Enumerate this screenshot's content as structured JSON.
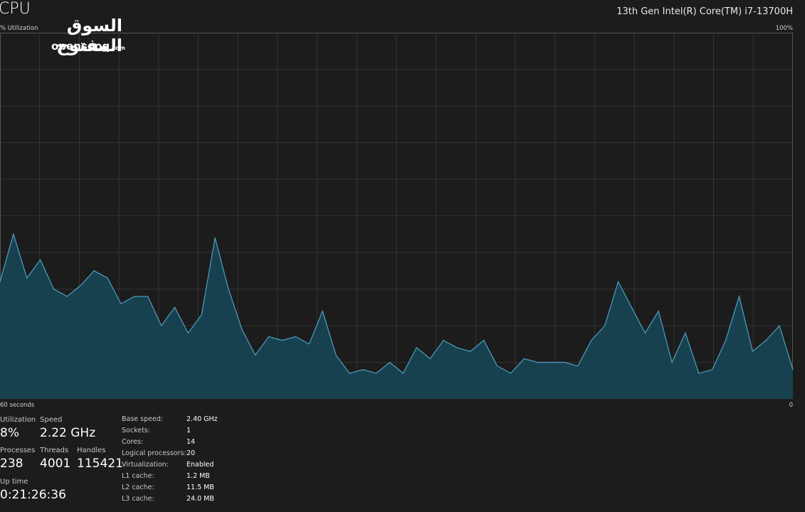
{
  "header": {
    "title": "CPU",
    "cpu_name": "13th Gen Intel(R) Core(TM) i7-13700H"
  },
  "watermark": {
    "arabic": "السوق المفتوح",
    "brand": "opensooq",
    "domain": ".com"
  },
  "graph": {
    "y_label": "% Utilization",
    "y_max_label": "100%",
    "x_left_label": "60 seconds",
    "x_right_label": "0",
    "line_color": "#4f9fc2",
    "fill_color": "#18414f",
    "grid_color": "#3a3a3a"
  },
  "chart_data": {
    "type": "area",
    "ylim": [
      0,
      100
    ],
    "grid": true,
    "values": [
      32,
      45,
      33,
      38,
      30,
      28,
      31,
      35,
      33,
      26,
      28,
      28,
      20,
      25,
      18,
      23,
      44,
      30,
      19,
      12,
      17,
      16,
      17,
      15,
      24,
      12,
      7,
      8,
      7,
      10,
      7,
      14,
      11,
      16,
      14,
      13,
      16,
      9,
      7,
      11,
      10,
      10,
      10,
      9,
      16,
      20,
      32,
      25,
      18,
      24,
      10,
      18,
      7,
      8,
      16,
      28,
      13,
      16,
      20,
      8
    ]
  },
  "stats": {
    "utilization": {
      "label": "Utilization",
      "value": "8%"
    },
    "speed": {
      "label": "Speed",
      "value": "2.22 GHz"
    },
    "processes": {
      "label": "Processes",
      "value": "238"
    },
    "threads": {
      "label": "Threads",
      "value": "4001"
    },
    "handles": {
      "label": "Handles",
      "value": "115421"
    },
    "uptime": {
      "label": "Up time",
      "value": "0:21:26:36"
    }
  },
  "info": [
    {
      "label": "Base speed:",
      "value": "2.40 GHz"
    },
    {
      "label": "Sockets:",
      "value": "1"
    },
    {
      "label": "Cores:",
      "value": "14"
    },
    {
      "label": "Logical processors:",
      "value": "20"
    },
    {
      "label": "Virtualization:",
      "value": "Enabled"
    },
    {
      "label": "L1 cache:",
      "value": "1.2 MB"
    },
    {
      "label": "L2 cache:",
      "value": "11.5 MB"
    },
    {
      "label": "L3 cache:",
      "value": "24.0 MB"
    }
  ]
}
